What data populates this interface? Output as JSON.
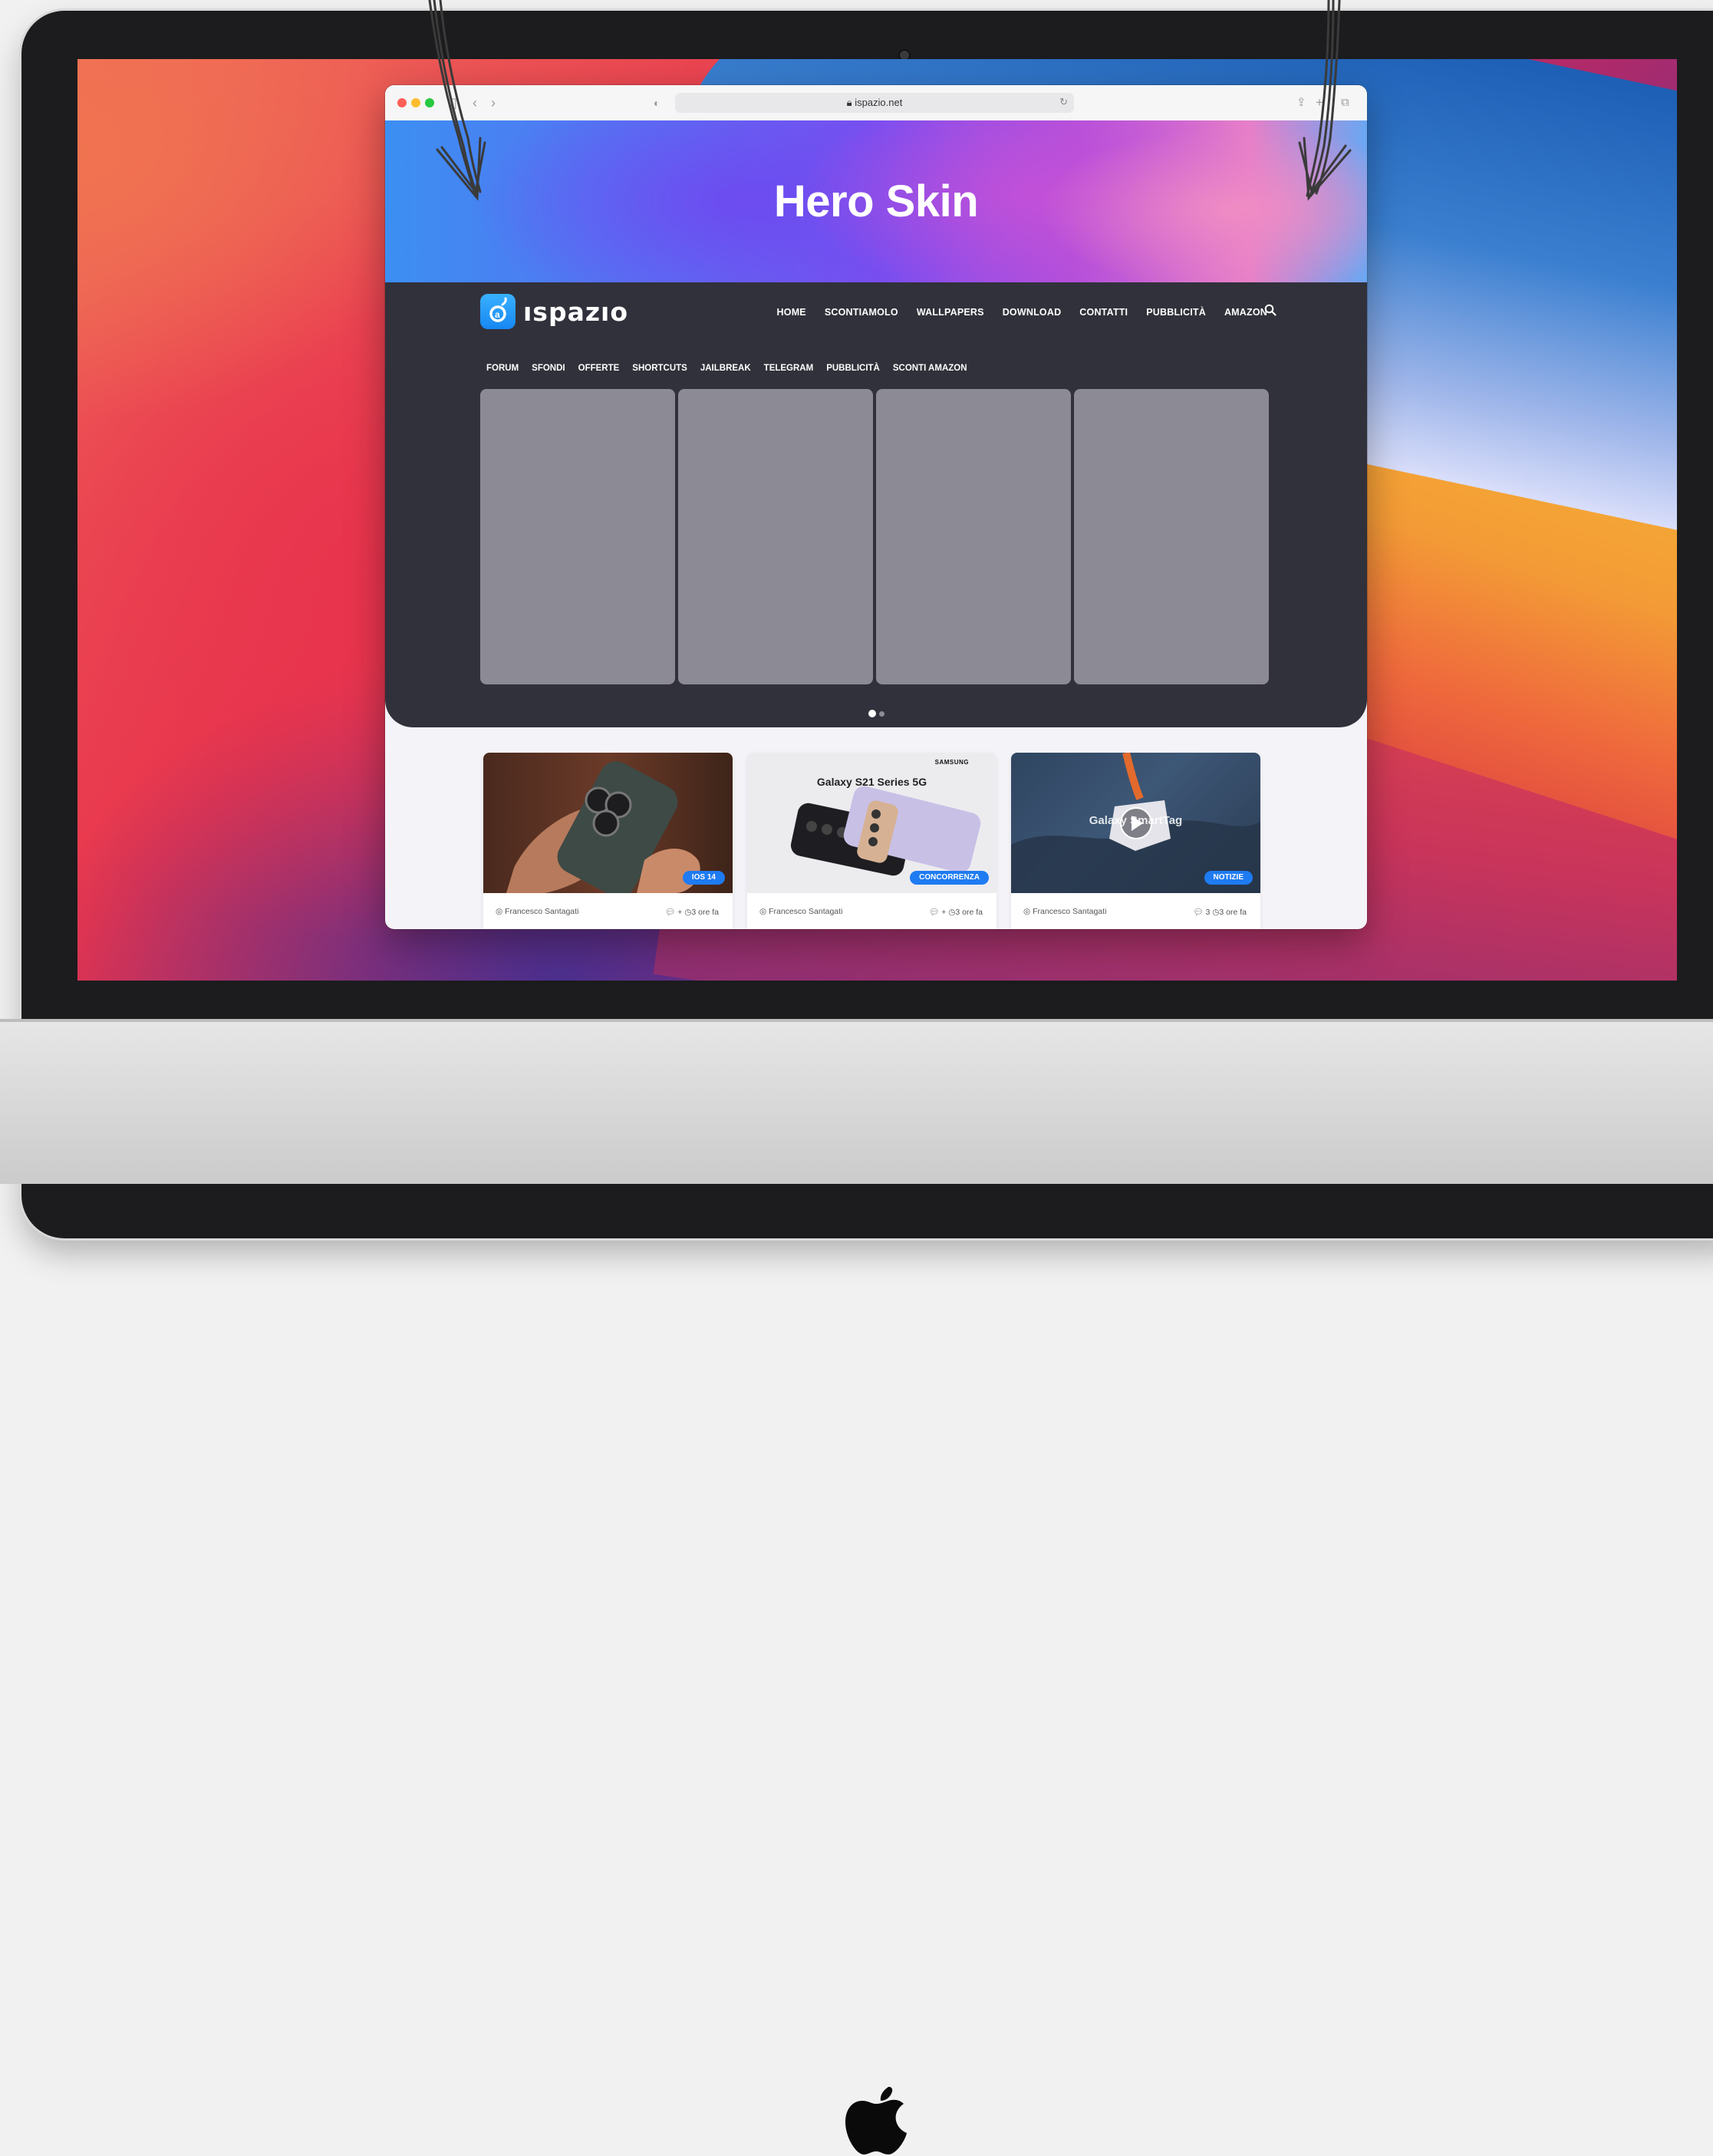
{
  "browser": {
    "url": "ispazio.net"
  },
  "hero": {
    "title": "Hero Skin"
  },
  "site": {
    "logo_text": "ıspazıo",
    "main_nav": [
      "HOME",
      "SCONTIAMOLO",
      "WALLPAPERS",
      "DOWNLOAD",
      "CONTATTI",
      "PUBBLICITÀ",
      "AMAZON"
    ],
    "sub_nav": [
      "FORUM",
      "SFONDI",
      "OFFERTE",
      "SHORTCUTS",
      "JAILBREAK",
      "TELEGRAM",
      "PUBBLICITÀ",
      "SCONTI AMAZON"
    ],
    "slider_pages": 2,
    "slider_active_page": 1
  },
  "cards": [
    {
      "badge": "IOS 14",
      "author": "Francesco Santagati",
      "comments": "+",
      "time": "3 ore fa"
    },
    {
      "badge": "CONCORRENZA",
      "author": "Francesco Santagati",
      "comments": "+",
      "time": "3 ore fa",
      "image_brand": "SAMSUNG",
      "image_title": "Galaxy S21 Series 5G"
    },
    {
      "badge": "NOTIZIE",
      "author": "Francesco Santagati",
      "comments": "3",
      "time": "3 ore fa",
      "image_title": "Galaxy SmartTag"
    }
  ],
  "colors": {
    "site_dark": "#31313b",
    "slide_placeholder": "#8c8b95",
    "badge_blue": "#1e7bf2"
  }
}
